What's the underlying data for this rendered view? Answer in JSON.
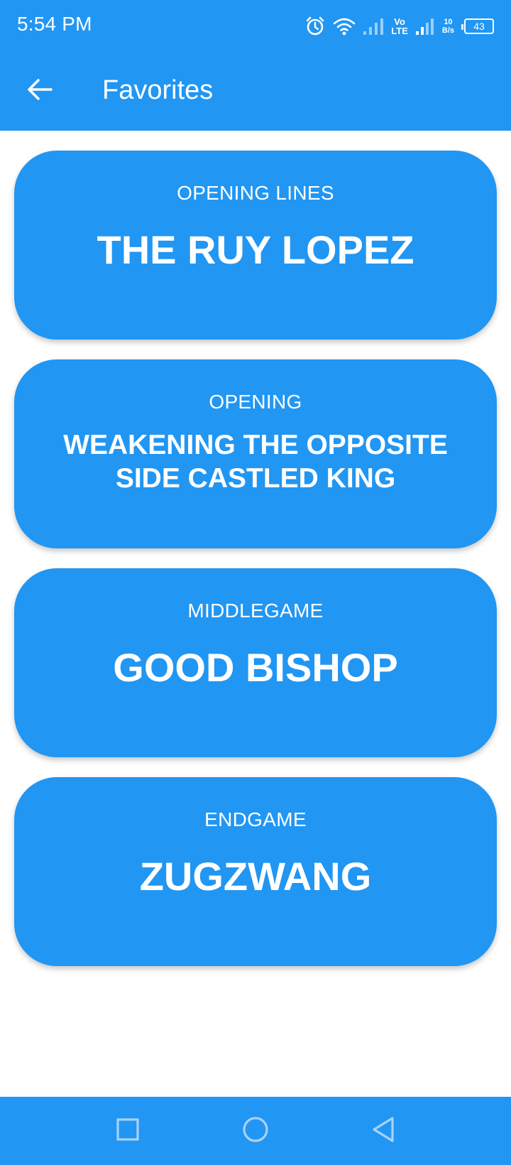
{
  "status_bar": {
    "time": "5:54 PM",
    "volte_top": "Vo",
    "volte_bottom": "LTE",
    "net_speed_value": "10",
    "net_speed_unit": "B/s",
    "battery": "43",
    "icons": [
      "alarm-icon",
      "wifi-icon",
      "signal-icon",
      "volte-icon",
      "signal-icon",
      "battery-icon"
    ]
  },
  "toolbar": {
    "title": "Favorites",
    "back_icon": "arrow-left-icon"
  },
  "favorites": [
    {
      "category": "OPENING LINES",
      "title": "THE RUY LOPEZ"
    },
    {
      "category": "OPENING",
      "title": "WEAKENING THE OPPOSITE SIDE CASTLED KING"
    },
    {
      "category": "MIDDLEGAME",
      "title": "GOOD BISHOP"
    },
    {
      "category": "ENDGAME",
      "title": "ZUGZWANG"
    }
  ],
  "nav_bar": {
    "icons": [
      "recents-square-icon",
      "home-circle-icon",
      "back-triangle-icon"
    ]
  },
  "colors": {
    "primary": "#2196F3",
    "on_primary": "#FFFFFF",
    "background": "#FFFFFF"
  }
}
